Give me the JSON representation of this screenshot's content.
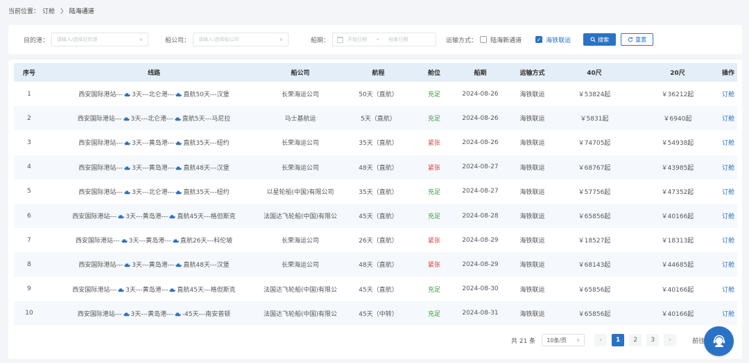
{
  "breadcrumb": {
    "prefix": "当前位置：",
    "parent": "订舱",
    "current": "陆海通道"
  },
  "filters": {
    "destination": {
      "label": "目的港：",
      "placeholder": "请输入/选择目的港"
    },
    "carrier": {
      "label": "船公司：",
      "placeholder": "请输入/选择船公司"
    },
    "sailing": {
      "label": "船期：",
      "start_placeholder": "开始日期",
      "end_placeholder": "结束日期",
      "separator": "-"
    },
    "transport": {
      "label": "运输方式：",
      "options": [
        {
          "label": "陆海新通道",
          "checked": false
        },
        {
          "label": "海铁联运",
          "checked": true
        }
      ]
    },
    "search_label": "搜索",
    "reset_label": "重置"
  },
  "table": {
    "headers": [
      "序号",
      "线路",
      "船公司",
      "航程",
      "舱位",
      "船期",
      "运输方式",
      "40尺",
      "20尺",
      "操作"
    ],
    "rows": [
      {
        "no": "1",
        "route_a": "西安国际港站---",
        "route_b": "3天---北仑港---",
        "route_c": "直航50天---汉堡",
        "carrier": "长荣海运公司",
        "voyage": "50天（直航）",
        "space": "充足",
        "space_status": "ok",
        "date": "2024-08-26",
        "mode": "海铁联运",
        "p40": "￥53824起",
        "p20": "￥36212起",
        "action": "订舱"
      },
      {
        "no": "2",
        "route_a": "西安国际港站---",
        "route_b": "3天---北仑港---",
        "route_c": "直航5天---马尼拉",
        "carrier": "马士基航运",
        "voyage": "5天（直航）",
        "space": "充足",
        "space_status": "ok",
        "date": "2024-08-26",
        "mode": "海铁联运",
        "p40": "￥5831起",
        "p20": "￥6940起",
        "action": "订舱"
      },
      {
        "no": "3",
        "route_a": "西安国际港站---",
        "route_b": "3天---黄岛港---",
        "route_c": "直航35天---纽约",
        "carrier": "长荣海运公司",
        "voyage": "35天（直航）",
        "space": "紧张",
        "space_status": "tight",
        "date": "2024-08-26",
        "mode": "海铁联运",
        "p40": "￥74705起",
        "p20": "￥54938起",
        "action": "订舱"
      },
      {
        "no": "4",
        "route_a": "西安国际港站---",
        "route_b": "3天---黄岛港---",
        "route_c": "直航48天---汉堡",
        "carrier": "长荣海运公司",
        "voyage": "48天（直航）",
        "space": "紧张",
        "space_status": "tight",
        "date": "2024-08-27",
        "mode": "海铁联运",
        "p40": "￥68767起",
        "p20": "￥43985起",
        "action": "订舱"
      },
      {
        "no": "5",
        "route_a": "西安国际港站---",
        "route_b": "3天---北仑港---",
        "route_c": "直航35天---纽约",
        "carrier": "以星轮船(中国)有限公司",
        "voyage": "35天（直航）",
        "space": "充足",
        "space_status": "ok",
        "date": "2024-08-27",
        "mode": "海铁联运",
        "p40": "￥57756起",
        "p20": "￥47352起",
        "action": "订舱"
      },
      {
        "no": "6",
        "route_a": "西安国际港站---",
        "route_b": "3天---黄岛港---",
        "route_c": "直航45天---格但斯克",
        "carrier": "法国达飞轮船(中国)有限公司",
        "voyage": "45天（直航）",
        "space": "充足",
        "space_status": "ok",
        "date": "2024-08-28",
        "mode": "海铁联运",
        "p40": "￥65856起",
        "p20": "￥40166起",
        "action": "订舱"
      },
      {
        "no": "7",
        "route_a": "西安国际港站---",
        "route_b": "3天---黄岛港---",
        "route_c": "直航26天---科伦坡",
        "carrier": "长荣海运公司",
        "voyage": "26天（直航）",
        "space": "紧张",
        "space_status": "tight",
        "date": "2024-08-29",
        "mode": "海铁联运",
        "p40": "￥18527起",
        "p20": "￥18313起",
        "action": "订舱"
      },
      {
        "no": "8",
        "route_a": "西安国际港站---",
        "route_b": "3天---黄岛港---",
        "route_c": "直航48天---汉堡",
        "carrier": "长荣海运公司",
        "voyage": "48天（直航）",
        "space": "紧张",
        "space_status": "tight",
        "date": "2024-08-29",
        "mode": "海铁联运",
        "p40": "￥68143起",
        "p20": "￥44685起",
        "action": "订舱"
      },
      {
        "no": "9",
        "route_a": "西安国际港站---",
        "route_b": "3天---黄岛港---",
        "route_c": "直航45天---格但斯克",
        "carrier": "法国达飞轮船(中国)有限公司",
        "voyage": "45天（直航）",
        "space": "充足",
        "space_status": "ok",
        "date": "2024-08-30",
        "mode": "海铁联运",
        "p40": "￥65856起",
        "p20": "￥40166起",
        "action": "订舱"
      },
      {
        "no": "10",
        "route_a": "西安国际港站---",
        "route_b": "3天---黄岛港---",
        "route_c": "-45天---南安普顿",
        "carrier": "法国达飞轮船(中国)有限公司",
        "voyage": "45天（中转）",
        "space": "充足",
        "space_status": "ok",
        "date": "2024-08-31",
        "mode": "海铁联运",
        "p40": "￥65856起",
        "p20": "￥40166起",
        "action": "订舱"
      }
    ]
  },
  "pagination": {
    "total_text": "共 21 条",
    "page_size": "10条/页",
    "pages": [
      "1",
      "2",
      "3"
    ],
    "current_page": "1",
    "goto_label": "前往"
  },
  "icons": {
    "ship": "ship-icon",
    "support": "customer-service-icon",
    "search": "search-icon",
    "reset": "refresh-icon"
  },
  "colors": {
    "primary": "#2a72c5",
    "ok": "#3b9a3b",
    "tight": "#d8473e",
    "header_bg": "#e4eef9"
  }
}
